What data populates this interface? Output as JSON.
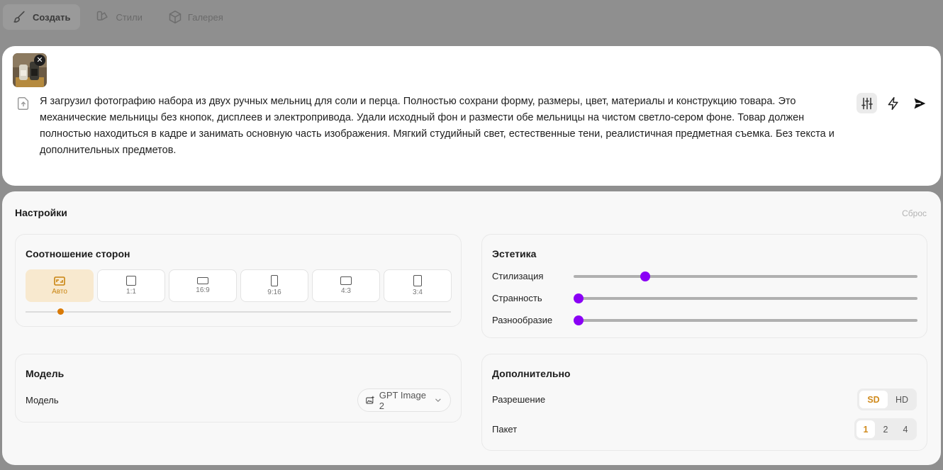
{
  "nav": {
    "create": "Создать",
    "styles": "Стили",
    "gallery": "Галерея"
  },
  "prompt": {
    "text": "Я загрузил фотографию набора из двух ручных мельниц для соли и перца. Полностью сохрани форму, размеры, цвет, материалы и конструкцию товара. Это механические мельницы без кнопок, дисплеев и электропривода. Удали исходный фон и размести обе мельницы на чистом светло-сером фоне. Товар должен полностью находиться в кадре и занимать основную часть изображения. Мягкий студийный свет, естественные тени, реалистичная предметная съемка. Без текста и дополнительных предметов.",
    "close_glyph": "✕"
  },
  "settings": {
    "title": "Настройки",
    "reset": "Сброс"
  },
  "aspect": {
    "title": "Соотношение сторон",
    "options": [
      {
        "label": "Авто",
        "active": true
      },
      {
        "label": "1:1"
      },
      {
        "label": "16:9"
      },
      {
        "label": "9:16"
      },
      {
        "label": "4:3"
      },
      {
        "label": "3:4"
      }
    ],
    "selected_index": 0
  },
  "aesthetics": {
    "title": "Эстетика",
    "sliders": [
      {
        "label": "Стилизация",
        "value": 0.2
      },
      {
        "label": "Странность",
        "value": 0.0
      },
      {
        "label": "Разнообразие",
        "value": 0.0
      }
    ],
    "accent_color": "#8a00f5"
  },
  "model": {
    "title": "Модель",
    "label": "Модель",
    "selected": "GPT Image 2"
  },
  "extra": {
    "title": "Дополнительно",
    "resolution_label": "Разрешение",
    "resolution_options": [
      "SD",
      "HD"
    ],
    "resolution_selected": "SD",
    "batch_label": "Пакет",
    "batch_options": [
      "1",
      "2",
      "4"
    ],
    "batch_selected": "1",
    "accent_color": "#d08a1c"
  }
}
